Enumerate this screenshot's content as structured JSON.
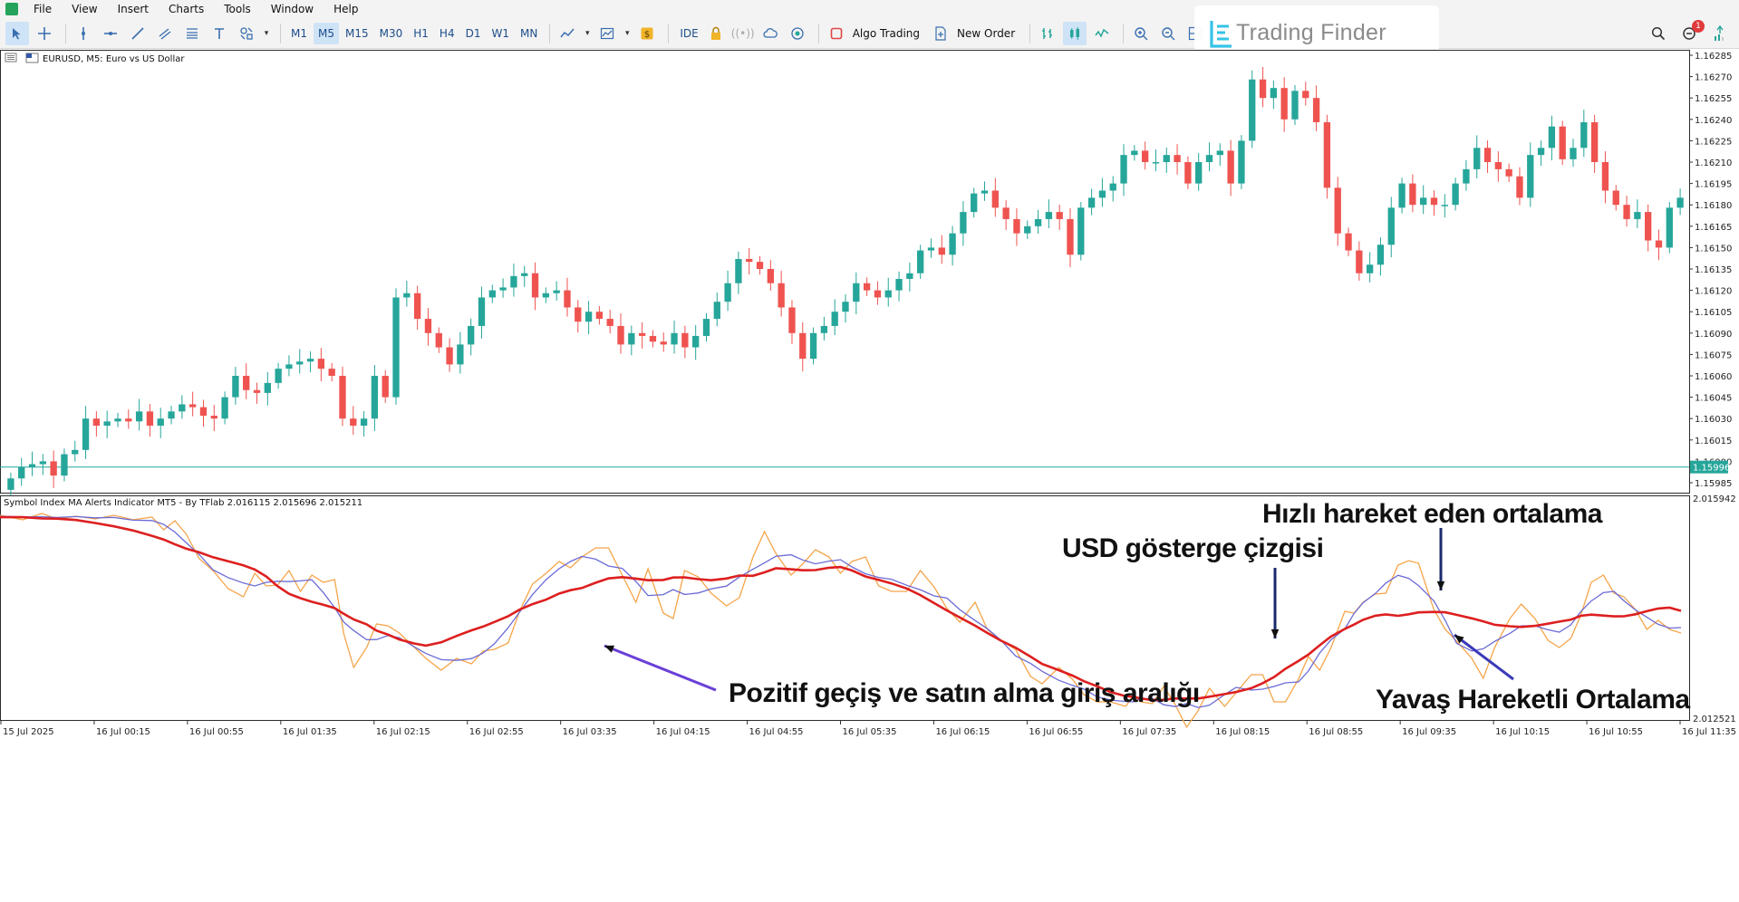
{
  "menu": [
    "File",
    "View",
    "Insert",
    "Charts",
    "Tools",
    "Window",
    "Help"
  ],
  "toolbar": {
    "timeframes": [
      "M1",
      "M5",
      "M15",
      "M30",
      "H1",
      "H4",
      "D1",
      "W1",
      "MN"
    ],
    "active_timeframe": "M5",
    "ide_label": "IDE",
    "algo_trading_label": "Algo Trading",
    "new_order_label": "New Order"
  },
  "brand": {
    "name": "Trading Finder"
  },
  "notification_count": "1",
  "chart": {
    "symbol_caption": "EURUSD, M5:  Euro vs US Dollar",
    "price_labels": [
      "1.16285",
      "1.16270",
      "1.16255",
      "1.16240",
      "1.16225",
      "1.16210",
      "1.16195",
      "1.16180",
      "1.16165",
      "1.16150",
      "1.16135",
      "1.16120",
      "1.16105",
      "1.16090",
      "1.16075",
      "1.16060",
      "1.16045",
      "1.16030",
      "1.16015",
      "1.16000",
      "1.15985"
    ],
    "current_price": "1.15996",
    "current_price_line_color": "#26a69a",
    "bull_color": "#26a69a",
    "bear_color": "#ef5350",
    "indicator_caption": "Symbol Index MA Alerts Indicator MT5 - By TFlab 2.016115 2.015696 2.015211",
    "indicator_top_value": "2.015942",
    "indicator_bottom_value": "2.012521",
    "time_labels": [
      "15 Jul 2025",
      "16 Jul 00:15",
      "16 Jul 00:55",
      "16 Jul 01:35",
      "16 Jul 02:15",
      "16 Jul 02:55",
      "16 Jul 03:35",
      "16 Jul 04:15",
      "16 Jul 04:55",
      "16 Jul 05:35",
      "16 Jul 06:15",
      "16 Jul 06:55",
      "16 Jul 07:35",
      "16 Jul 08:15",
      "16 Jul 08:55",
      "16 Jul 09:35",
      "16 Jul 10:15",
      "16 Jul 10:55",
      "16 Jul 11:35"
    ],
    "line_colors": {
      "usd_index": "#f5a54a",
      "fast_ma": "#6b6bd6",
      "slow_ma": "#dd1f1f"
    }
  },
  "annotations": {
    "fast_ma": "Hızlı hareket eden ortalama",
    "usd_line": "USD gösterge çizgisi",
    "positive_cross": "Pozitif geçiş ve satın alma giriş aralığı",
    "slow_ma": "Yavaş Hareketli Ortalama"
  },
  "chart_data": {
    "type": "candlestick",
    "series_close": [
      1.15988,
      1.15996,
      1.15998,
      1.16,
      1.1599,
      1.16005,
      1.16008,
      1.1603,
      1.16025,
      1.16028,
      1.1603,
      1.16028,
      1.16035,
      1.16025,
      1.1603,
      1.16035,
      1.1604,
      1.16038,
      1.16032,
      1.1603,
      1.16045,
      1.1606,
      1.1605,
      1.16048,
      1.16055,
      1.16065,
      1.16068,
      1.1607,
      1.16072,
      1.16065,
      1.1606,
      1.1603,
      1.16025,
      1.1603,
      1.1606,
      1.16045,
      1.16115,
      1.16118,
      1.161,
      1.1609,
      1.1608,
      1.16068,
      1.16082,
      1.16095,
      1.16115,
      1.1612,
      1.16122,
      1.1613,
      1.16132,
      1.16115,
      1.16118,
      1.1612,
      1.16108,
      1.16098,
      1.16105,
      1.161,
      1.16095,
      1.16082,
      1.1609,
      1.16088,
      1.16084,
      1.16082,
      1.1609,
      1.1608,
      1.16088,
      1.161,
      1.16112,
      1.16125,
      1.16142,
      1.1614,
      1.16135,
      1.16125,
      1.16108,
      1.1609,
      1.16072,
      1.1609,
      1.16095,
      1.16105,
      1.16112,
      1.16125,
      1.1612,
      1.16115,
      1.1612,
      1.16128,
      1.16132,
      1.16148,
      1.1615,
      1.16145,
      1.1616,
      1.16175,
      1.16188,
      1.1619,
      1.16178,
      1.1617,
      1.1616,
      1.16165,
      1.1617,
      1.16175,
      1.1617,
      1.16145,
      1.16178,
      1.16185,
      1.1619,
      1.16195,
      1.16215,
      1.16218,
      1.1621,
      1.1621,
      1.16215,
      1.1621,
      1.16195,
      1.1621,
      1.16215,
      1.16218,
      1.16195,
      1.16225,
      1.16268,
      1.16255,
      1.16262,
      1.1624,
      1.1626,
      1.16255,
      1.16238,
      1.16192,
      1.1616,
      1.16148,
      1.16132,
      1.16138,
      1.16152,
      1.16178,
      1.16195,
      1.1618,
      1.16185,
      1.1618,
      1.1618,
      1.16195,
      1.16205,
      1.1622,
      1.1621,
      1.16205,
      1.162,
      1.16185,
      1.16215,
      1.1622,
      1.16235,
      1.16212,
      1.1622,
      1.16238,
      1.1621,
      1.1619,
      1.1618,
      1.1617,
      1.16175,
      1.16155,
      1.1615,
      1.16178,
      1.16185
    ]
  }
}
